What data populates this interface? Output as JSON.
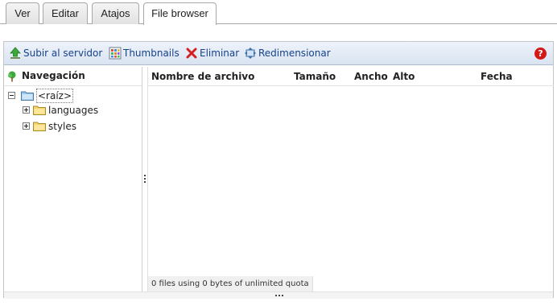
{
  "tabs": [
    {
      "label": "Ver",
      "active": false
    },
    {
      "label": "Editar",
      "active": false
    },
    {
      "label": "Atajos",
      "active": false
    },
    {
      "label": "File browser",
      "active": true
    }
  ],
  "toolbar": {
    "upload_label": "Subir al servidor",
    "thumbnails_label": "Thumbnails",
    "delete_label": "Eliminar",
    "resize_label": "Redimensionar",
    "help_label": "?"
  },
  "navigation": {
    "title": "Navegación",
    "tree": {
      "root": "<raíz>",
      "children": [
        "languages",
        "styles"
      ]
    }
  },
  "files": {
    "columns": [
      "Nombre de archivo",
      "Tamaño",
      "Ancho",
      "Alto",
      "Fecha"
    ],
    "rows": [],
    "status": "0 files using 0 bytes of unlimited quota"
  },
  "colors": {
    "toolbar_text": "#15428b",
    "help_icon": "#d41818",
    "folder": "#f5d46a",
    "root_folder": "#9cc8ec"
  }
}
